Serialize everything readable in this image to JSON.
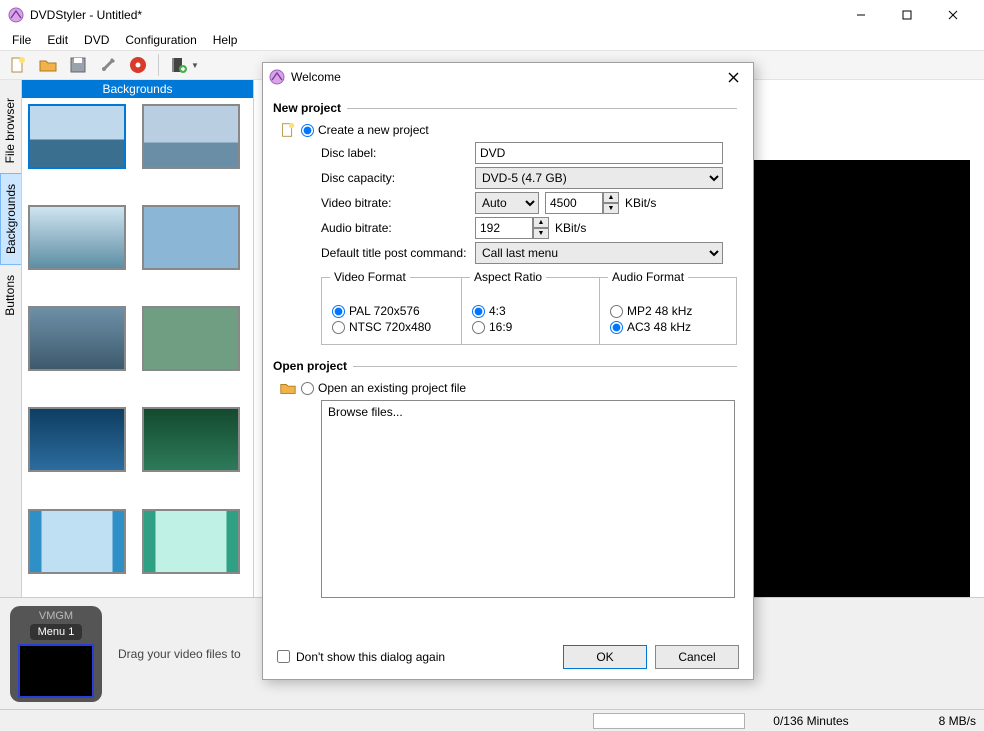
{
  "window": {
    "title": "DVDStyler - Untitled*",
    "minimize_tooltip": "Minimize",
    "maximize_tooltip": "Maximize",
    "close_tooltip": "Close"
  },
  "menu": {
    "items": [
      "File",
      "Edit",
      "DVD",
      "Configuration",
      "Help"
    ]
  },
  "toolbar": {
    "new_tooltip": "New",
    "open_tooltip": "Open",
    "save_tooltip": "Save",
    "settings_tooltip": "Settings",
    "burn_tooltip": "Burn",
    "add_tooltip": "Add file"
  },
  "sidetabs": {
    "file_browser": "File browser",
    "backgrounds": "Backgrounds",
    "buttons": "Buttons"
  },
  "bg_panel": {
    "header": "Backgrounds"
  },
  "timeline": {
    "vmgm": "VMGM",
    "menu1": "Menu 1",
    "hint": "Drag your video files to"
  },
  "status": {
    "minutes": "0/136 Minutes",
    "rate": "8 MB/s"
  },
  "dialog": {
    "title": "Welcome",
    "new_project": "New project",
    "create_new": "Create a new project",
    "disc_label_lbl": "Disc label:",
    "disc_label_val": "DVD",
    "disc_capacity_lbl": "Disc capacity:",
    "disc_capacity_val": "DVD-5 (4.7 GB)",
    "video_bitrate_lbl": "Video bitrate:",
    "video_bitrate_mode": "Auto",
    "video_bitrate_val": "4500",
    "audio_bitrate_lbl": "Audio bitrate:",
    "audio_bitrate_val": "192",
    "kbits": "KBit/s",
    "default_cmd_lbl": "Default title post command:",
    "default_cmd_val": "Call last menu",
    "video_format": "Video Format",
    "pal": "PAL 720x576",
    "ntsc": "NTSC 720x480",
    "aspect_ratio": "Aspect Ratio",
    "ar_43": "4:3",
    "ar_169": "16:9",
    "audio_format": "Audio Format",
    "mp2": "MP2 48 kHz",
    "ac3": "AC3 48 kHz",
    "open_project": "Open project",
    "open_existing": "Open an existing project file",
    "browse_files": "Browse files...",
    "dont_show": "Don't show this dialog again",
    "ok": "OK",
    "cancel": "Cancel"
  }
}
